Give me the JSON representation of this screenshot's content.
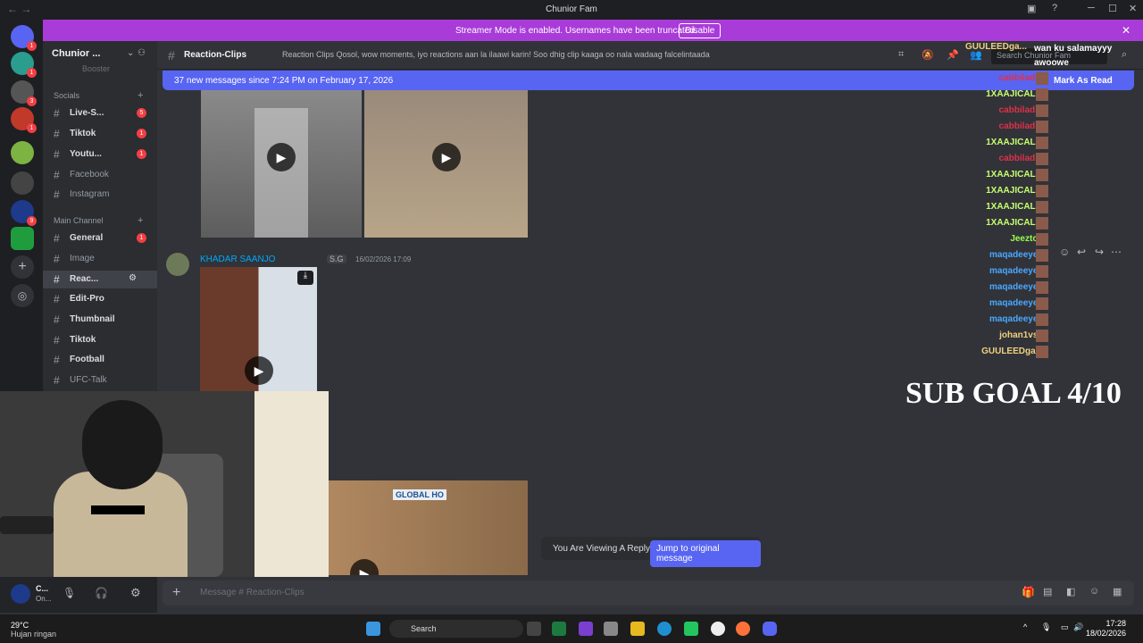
{
  "window": {
    "title": "Chunior Fam"
  },
  "streamer_banner": {
    "text": "Streamer Mode is enabled. Usernames have been truncated.",
    "button": "Disable"
  },
  "server": {
    "name": "Chunior ...",
    "booster_text": "Booster"
  },
  "categories": {
    "socials": "Socials",
    "main": "Main Channel"
  },
  "channels": [
    {
      "name": "Live-S...",
      "badge": "5"
    },
    {
      "name": "Tiktok",
      "badge": "1"
    },
    {
      "name": "Youtu...",
      "badge": "1"
    },
    {
      "name": "Facebook",
      "badge": ""
    },
    {
      "name": "Instagram",
      "badge": ""
    },
    {
      "name": "General",
      "badge": "1"
    },
    {
      "name": "Image",
      "badge": ""
    },
    {
      "name": "Reac...",
      "badge": ""
    },
    {
      "name": "Edit-Pro",
      "badge": ""
    },
    {
      "name": "Thumbnail",
      "badge": ""
    },
    {
      "name": "Tiktok",
      "badge": ""
    },
    {
      "name": "Football",
      "badge": ""
    },
    {
      "name": "UFC-Talk",
      "badge": ""
    }
  ],
  "header": {
    "channel": "Reaction-Clips",
    "topic": "Reaction Clips Qosol, wow moments, iyo reactions aan la ilaawi karin! Soo dhig clip kaaga oo nala wadaag falcelintaada",
    "search_placeholder": "Search Chunior Fam"
  },
  "new_messages": {
    "text": "37 new messages since 7:24 PM on February 17, 2026",
    "mark_read": "Mark As Read"
  },
  "message": {
    "username": "KHADAR SAANJO",
    "tag": "S.G",
    "timestamp": "16/02/2026 17:09"
  },
  "chat_overlay": [
    {
      "name": "GUULEEDga...",
      "msg": "wan ku salamayyy awoowe",
      "color": "#f0d080"
    },
    {
      "name": "cabbiladiif",
      "msg": "",
      "color": "#e0304a"
    },
    {
      "name": "1XAAJICAL...",
      "msg": "",
      "color": "#c8ff70"
    },
    {
      "name": "cabbiladiif",
      "msg": "",
      "color": "#e0304a"
    },
    {
      "name": "cabbiladiif",
      "msg": "",
      "color": "#e0304a"
    },
    {
      "name": "1XAAJICAL...",
      "msg": "",
      "color": "#c8ff70"
    },
    {
      "name": "cabbiladiif",
      "msg": "",
      "color": "#e0304a"
    },
    {
      "name": "1XAAJICAL...",
      "msg": "",
      "color": "#c8ff70"
    },
    {
      "name": "1XAAJICAL...",
      "msg": "",
      "color": "#c8ff70"
    },
    {
      "name": "1XAAJICAL...",
      "msg": "",
      "color": "#c8ff70"
    },
    {
      "name": "1XAAJICAL...",
      "msg": "",
      "color": "#c8ff70"
    },
    {
      "name": "Jeezto2",
      "msg": "",
      "color": "#9aff50"
    },
    {
      "name": "maqadeeyee",
      "msg": "",
      "color": "#4aa8ff"
    },
    {
      "name": "maqadeeyee",
      "msg": "",
      "color": "#4aa8ff"
    },
    {
      "name": "maqadeeyee",
      "msg": "",
      "color": "#4aa8ff"
    },
    {
      "name": "maqadeeyee",
      "msg": "",
      "color": "#4aa8ff"
    },
    {
      "name": "maqadeeyee",
      "msg": "",
      "color": "#4aa8ff"
    },
    {
      "name": "johan1vs0",
      "msg": "",
      "color": "#f0d080"
    },
    {
      "name": "GUULEEDga...",
      "msg": "",
      "color": "#f0d080"
    }
  ],
  "sub_goal": "SUB GOAL 4/10",
  "reply_bar": {
    "text": "You Are Viewing A Reply.",
    "button": "Jump to original message"
  },
  "composer": {
    "placeholder": "Message # Reaction-Clips"
  },
  "user_panel": {
    "name": "C...",
    "status": "On..."
  },
  "taskbar": {
    "temp": "29°C",
    "weather": "Hujan ringan",
    "search": "Search",
    "time": "17:28",
    "date": "18/02/2026"
  },
  "video_overlay_text": "GLOBAL HO"
}
